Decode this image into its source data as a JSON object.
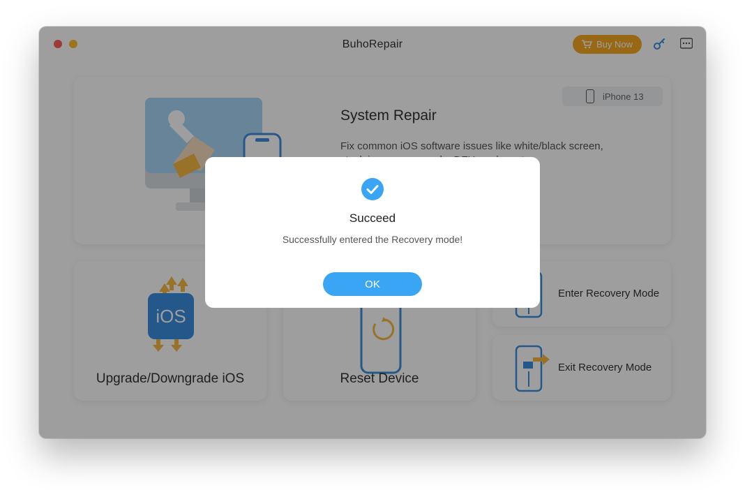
{
  "window": {
    "title": "BuhoRepair"
  },
  "header": {
    "buy_now_label": "Buy Now",
    "buy_now_icon": "cart-icon",
    "register_icon": "key-icon",
    "menu_icon": "menu-icon"
  },
  "system_repair": {
    "title": "System Repair",
    "description": "Fix common iOS software issues like white/black screen, stuck in recovery mode, DFU mode, ect.",
    "device": "iPhone 13"
  },
  "features": {
    "upgrade": "Upgrade/Downgrade iOS",
    "reset": "Reset Device",
    "enter_recovery": "Enter Recovery Mode",
    "exit_recovery": "Exit Recovery Mode",
    "ios_badge": "iOS"
  },
  "dialog": {
    "title": "Succeed",
    "message": "Successfully entered the Recovery mode!",
    "ok_label": "OK",
    "icon": "success-check-icon"
  },
  "colors": {
    "accent": "#3aa5f5",
    "buy_button": "#f7a823",
    "overlay": "rgba(0,0,0,0.38)"
  }
}
